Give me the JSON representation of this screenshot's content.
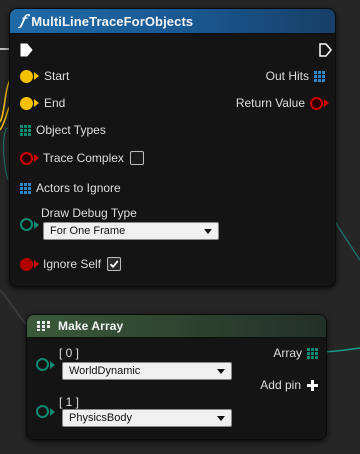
{
  "colors": {
    "background": "#262626",
    "exec_wire": "#f0f0f0",
    "bool_wire": "#f4c000",
    "object_wire": "#1a9a8f",
    "function_header": "#1b5f9a",
    "make_array_header": "#2f4a2e",
    "bool_pin": "#cc0000",
    "array_pin": "#2f89c9",
    "byte_pin": "#0b8a72"
  },
  "trace_node": {
    "icon": "function-icon",
    "title": "MultiLineTraceForObjects",
    "inputs": {
      "start": "Start",
      "end": "End",
      "object_types": "Object Types",
      "trace_complex": "Trace Complex",
      "trace_complex_checked": false,
      "actors_to_ignore": "Actors to Ignore",
      "draw_debug_type": "Draw Debug Type",
      "draw_debug_value": "For One Frame",
      "ignore_self": "Ignore Self",
      "ignore_self_checked": true
    },
    "outputs": {
      "out_hits": "Out Hits",
      "return_value": "Return Value"
    }
  },
  "make_array_node": {
    "icon": "make-array-icon",
    "title": "Make Array",
    "items": [
      {
        "index": "[ 0 ]",
        "value": "WorldDynamic"
      },
      {
        "index": "[ 1 ]",
        "value": "PhysicsBody"
      }
    ],
    "output": "Array",
    "add_pin": "Add pin",
    "add_pin_icon": "plus-icon"
  }
}
